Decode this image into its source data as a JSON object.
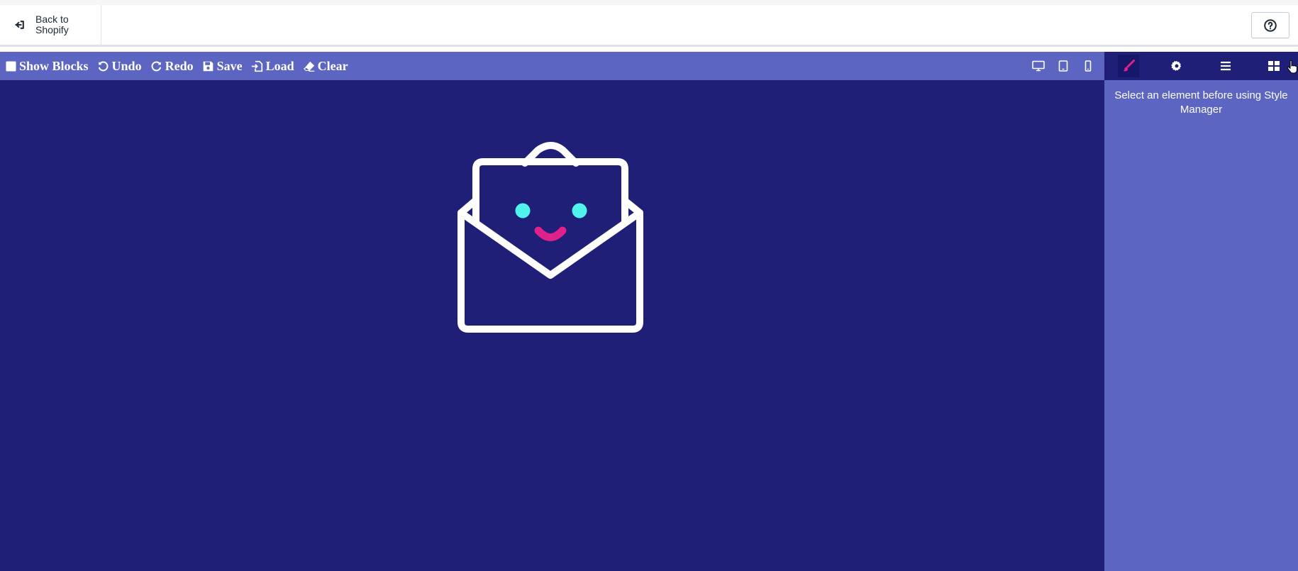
{
  "topbar": {
    "back_label": "Back to Shopify",
    "help_icon": "question-circle-icon"
  },
  "toolbar": {
    "show_blocks": "Show Blocks",
    "undo": "Undo",
    "redo": "Redo",
    "save": "Save",
    "load": "Load",
    "clear": "Clear",
    "devices": [
      "desktop-icon",
      "tablet-icon",
      "mobile-icon"
    ]
  },
  "panel": {
    "tabs": [
      "paint-brush-icon",
      "gear-icon",
      "bars-icon",
      "blocks-grid-icon"
    ],
    "active_tab": "paint-brush-icon",
    "message": "Select an element before using Style Manager"
  },
  "colors": {
    "toolbar_bg": "#5c66c2",
    "canvas_bg": "#1f1f78",
    "accent_pink": "#e0218a",
    "accent_cyan": "#4ff3ec"
  }
}
